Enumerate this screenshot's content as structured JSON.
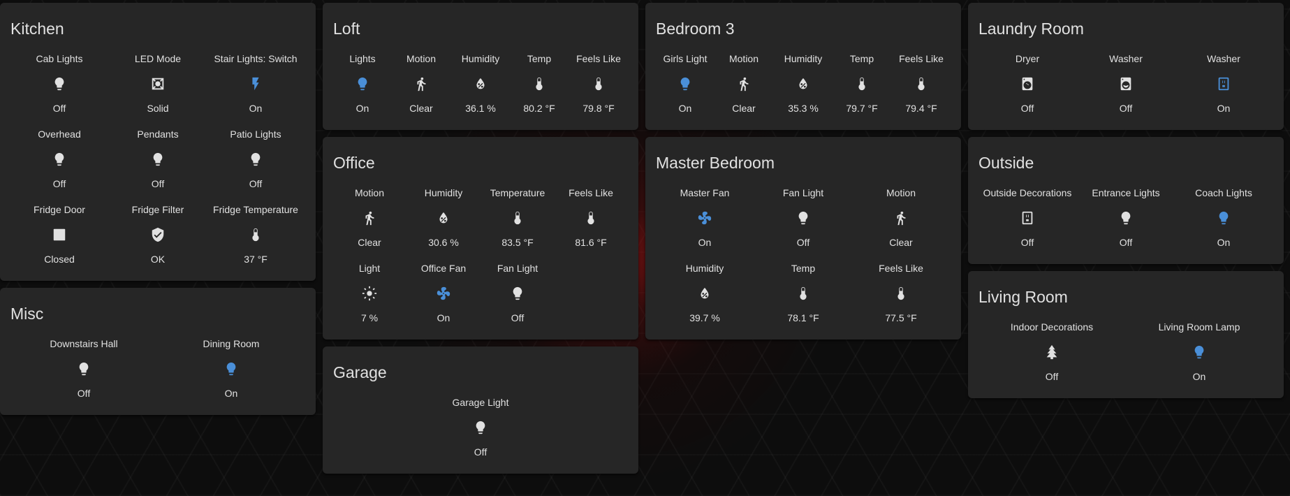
{
  "colors": {
    "active": "#4a8fd8",
    "inactive": "#e1e1e1",
    "card": "#262626"
  },
  "kitchen": {
    "title": "Kitchen",
    "items": [
      {
        "name": "Cab Lights",
        "state": "Off",
        "icon": "bulb-icon"
      },
      {
        "name": "LED Mode",
        "state": "Solid",
        "icon": "led-mode-icon"
      },
      {
        "name": "Stair Lights: Switch",
        "state": "On",
        "icon": "flash-icon"
      },
      {
        "name": "Overhead",
        "state": "Off",
        "icon": "bulb-icon"
      },
      {
        "name": "Pendants",
        "state": "Off",
        "icon": "bulb-icon"
      },
      {
        "name": "Patio Lights",
        "state": "Off",
        "icon": "bulb-icon"
      },
      {
        "name": "Fridge Door",
        "state": "Closed",
        "icon": "door-square-icon"
      },
      {
        "name": "Fridge Filter",
        "state": "OK",
        "icon": "shield-check-icon"
      },
      {
        "name": "Fridge Temperature",
        "state": "37 °F",
        "icon": "thermometer-icon"
      }
    ]
  },
  "misc": {
    "title": "Misc",
    "items": [
      {
        "name": "Downstairs Hall",
        "state": "Off",
        "icon": "bulb-icon"
      },
      {
        "name": "Dining Room",
        "state": "On",
        "icon": "bulb-icon"
      }
    ]
  },
  "loft": {
    "title": "Loft",
    "items": [
      {
        "name": "Lights",
        "state": "On",
        "icon": "bulb-icon"
      },
      {
        "name": "Motion",
        "state": "Clear",
        "icon": "walk-icon"
      },
      {
        "name": "Humidity",
        "state": "36.1 %",
        "icon": "water-percent-icon"
      },
      {
        "name": "Temp",
        "state": "80.2 °F",
        "icon": "thermometer-icon"
      },
      {
        "name": "Feels Like",
        "state": "79.8 °F",
        "icon": "thermometer-icon"
      }
    ]
  },
  "office": {
    "title": "Office",
    "items": [
      {
        "name": "Motion",
        "state": "Clear",
        "icon": "walk-icon"
      },
      {
        "name": "Humidity",
        "state": "30.6 %",
        "icon": "water-percent-icon"
      },
      {
        "name": "Temperature",
        "state": "83.5 °F",
        "icon": "thermometer-icon"
      },
      {
        "name": "Feels Like",
        "state": "81.6 °F",
        "icon": "thermometer-icon"
      },
      {
        "name": "Light",
        "state": "7 %",
        "icon": "sun-icon"
      },
      {
        "name": "Office Fan",
        "state": "On",
        "icon": "fan-icon"
      },
      {
        "name": "Fan Light",
        "state": "Off",
        "icon": "bulb-icon"
      }
    ]
  },
  "garage": {
    "title": "Garage",
    "items": [
      {
        "name": "Garage Light",
        "state": "Off",
        "icon": "bulb-icon"
      }
    ]
  },
  "bedroom3": {
    "title": "Bedroom 3",
    "items": [
      {
        "name": "Girls Light",
        "state": "On",
        "icon": "bulb-icon"
      },
      {
        "name": "Motion",
        "state": "Clear",
        "icon": "walk-icon"
      },
      {
        "name": "Humidity",
        "state": "35.3 %",
        "icon": "water-percent-icon"
      },
      {
        "name": "Temp",
        "state": "79.7 °F",
        "icon": "thermometer-icon"
      },
      {
        "name": "Feels Like",
        "state": "79.4 °F",
        "icon": "thermometer-icon"
      }
    ]
  },
  "master_bedroom": {
    "title": "Master Bedroom",
    "items": [
      {
        "name": "Master Fan",
        "state": "On",
        "icon": "fan-icon"
      },
      {
        "name": "Fan Light",
        "state": "Off",
        "icon": "bulb-icon"
      },
      {
        "name": "Motion",
        "state": "Clear",
        "icon": "walk-icon"
      },
      {
        "name": "Humidity",
        "state": "39.7 %",
        "icon": "water-percent-icon"
      },
      {
        "name": "Temp",
        "state": "78.1 °F",
        "icon": "thermometer-icon"
      },
      {
        "name": "Feels Like",
        "state": "77.5 °F",
        "icon": "thermometer-icon"
      }
    ]
  },
  "laundry": {
    "title": "Laundry Room",
    "items": [
      {
        "name": "Dryer",
        "state": "Off",
        "icon": "dryer-icon"
      },
      {
        "name": "Washer",
        "state": "Off",
        "icon": "washer-icon"
      },
      {
        "name": "Washer",
        "state": "On",
        "icon": "power-socket-icon"
      }
    ]
  },
  "outside": {
    "title": "Outside",
    "items": [
      {
        "name": "Outside Decorations",
        "state": "Off",
        "icon": "power-socket-icon"
      },
      {
        "name": "Entrance Lights",
        "state": "Off",
        "icon": "bulb-icon"
      },
      {
        "name": "Coach Lights",
        "state": "On",
        "icon": "bulb-icon"
      }
    ]
  },
  "living_room": {
    "title": "Living Room",
    "items": [
      {
        "name": "Indoor Decorations",
        "state": "Off",
        "icon": "pine-tree-icon"
      },
      {
        "name": "Living Room Lamp",
        "state": "On",
        "icon": "bulb-icon"
      }
    ]
  }
}
